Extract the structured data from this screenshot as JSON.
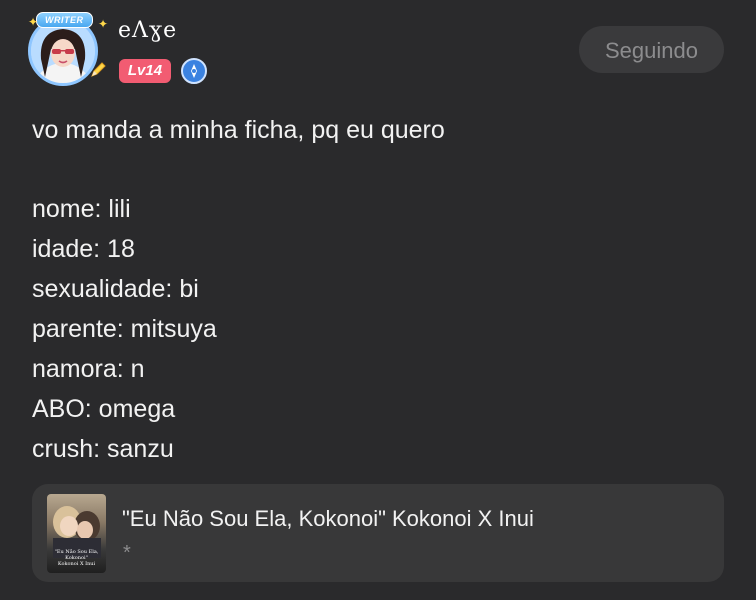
{
  "header": {
    "writer_badge": "WRITER",
    "username": "eɅɣe",
    "level": "Lv14",
    "follow_button_label": "Seguindo",
    "title_badge_icon": "compass-icon"
  },
  "post": {
    "intro": "vo manda a minha ficha, pq eu quero",
    "lines": [
      "nome: lili",
      "idade: 18",
      "sexualidade: bi",
      "parente: mitsuya",
      "namora: n",
      "ABO: omega",
      "crush: sanzu"
    ]
  },
  "story_card": {
    "title": "\"Eu Não Sou Ela, Kokonoi\" Kokonoi X Inui",
    "subtitle": "*",
    "cover_text": "\"Eu Não Sou Ela,\nKokonoi\"\nKokonoi X Inui"
  },
  "colors": {
    "background": "#2a2a2c",
    "level_badge": "#f25c72",
    "follow_button": "#3a3a3c",
    "card": "#383839"
  }
}
